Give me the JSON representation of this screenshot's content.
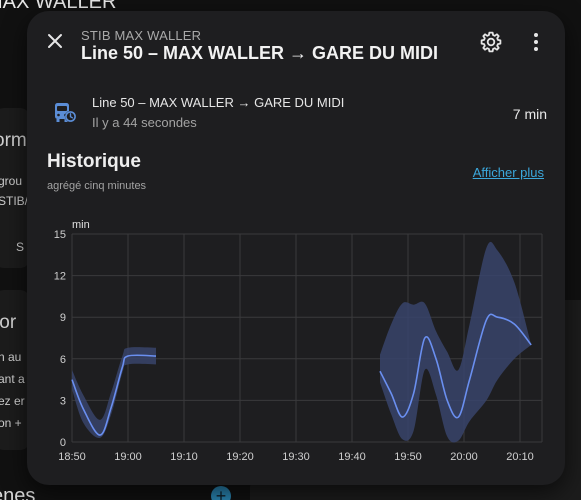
{
  "background": {
    "title": "MAX WALLER",
    "card1_lines": [
      "orm",
      "grou",
      "STIB/",
      "S"
    ],
    "card2_lines": [
      "tor",
      "n au",
      "ant a",
      "ez er",
      "on +"
    ],
    "bottom_title": "ènes",
    "plus": "+"
  },
  "dialog": {
    "subtitle": "STIB MAX WALLER",
    "title": "Line 50 – MAX WALLER → GARE DU MIDI",
    "entity": {
      "name": "Line 50 – MAX WALLER → GARE DU MIDI",
      "last_changed": "Il y a 44 secondes",
      "value": "7 min"
    },
    "history": {
      "title": "Historique",
      "subtitle": "agrégé cinq minutes",
      "show_more": "Afficher plus"
    }
  },
  "colors": {
    "accent": "#3ba8dc",
    "line": "#6a8ff0",
    "band": "#38446b",
    "icon": "#5b8dd6"
  },
  "chart_data": {
    "type": "line",
    "title": "",
    "xlabel": "",
    "ylabel": "min",
    "ylim": [
      0,
      15
    ],
    "yticks": [
      "0",
      "3",
      "6",
      "9",
      "12",
      "15"
    ],
    "xticks": [
      "18:50",
      "19:00",
      "19:10",
      "19:20",
      "19:30",
      "19:40",
      "19:50",
      "20:00",
      "20:10"
    ],
    "grid": true,
    "series": [
      {
        "segments": [
          {
            "points": [
              [
                "18:50",
                4.5
              ],
              [
                "18:52",
                2.4
              ],
              [
                "18:55",
                0.5
              ],
              [
                "18:57",
                2.5
              ],
              [
                "18:59",
                5.4
              ],
              [
                "19:00",
                6.2
              ],
              [
                "19:05",
                6.2
              ]
            ],
            "lower": [
              [
                "18:50",
                3.8
              ],
              [
                "18:52",
                1.4
              ],
              [
                "18:55",
                0.3
              ],
              [
                "18:57",
                2.0
              ],
              [
                "18:59",
                5.0
              ],
              [
                "19:00",
                5.6
              ],
              [
                "19:05",
                5.6
              ]
            ],
            "upper": [
              [
                "18:50",
                5.2
              ],
              [
                "18:52",
                3.4
              ],
              [
                "18:55",
                1.6
              ],
              [
                "18:57",
                3.6
              ],
              [
                "18:59",
                6.2
              ],
              [
                "19:00",
                6.8
              ],
              [
                "19:05",
                6.8
              ]
            ]
          },
          {
            "points": [
              [
                "19:45",
                5.1
              ],
              [
                "19:47",
                3.5
              ],
              [
                "19:49",
                1.8
              ],
              [
                "19:51",
                3.5
              ],
              [
                "19:53",
                7.5
              ],
              [
                "19:55",
                6.0
              ],
              [
                "19:57",
                3.0
              ],
              [
                "19:59",
                1.8
              ],
              [
                "20:01",
                4.5
              ],
              [
                "20:04",
                8.8
              ],
              [
                "20:06",
                9.0
              ],
              [
                "20:09",
                8.5
              ],
              [
                "20:12",
                7.0
              ]
            ],
            "lower": [
              [
                "19:45",
                4.3
              ],
              [
                "19:47",
                2.0
              ],
              [
                "19:49",
                0.2
              ],
              [
                "19:51",
                0.8
              ],
              [
                "19:53",
                5.2
              ],
              [
                "19:55",
                3.4
              ],
              [
                "19:57",
                0.4
              ],
              [
                "19:59",
                0.1
              ],
              [
                "20:01",
                1.5
              ],
              [
                "20:04",
                3.0
              ],
              [
                "20:06",
                4.5
              ],
              [
                "20:09",
                6.0
              ],
              [
                "20:12",
                7.0
              ]
            ],
            "upper": [
              [
                "19:45",
                6.3
              ],
              [
                "19:47",
                8.5
              ],
              [
                "19:49",
                10.0
              ],
              [
                "19:51",
                9.9
              ],
              [
                "19:53",
                10.0
              ],
              [
                "19:55",
                8.0
              ],
              [
                "19:57",
                6.5
              ],
              [
                "19:59",
                5.2
              ],
              [
                "20:01",
                8.5
              ],
              [
                "20:04",
                14.0
              ],
              [
                "20:06",
                13.8
              ],
              [
                "20:09",
                11.5
              ],
              [
                "20:12",
                7.0
              ]
            ]
          }
        ]
      }
    ]
  }
}
